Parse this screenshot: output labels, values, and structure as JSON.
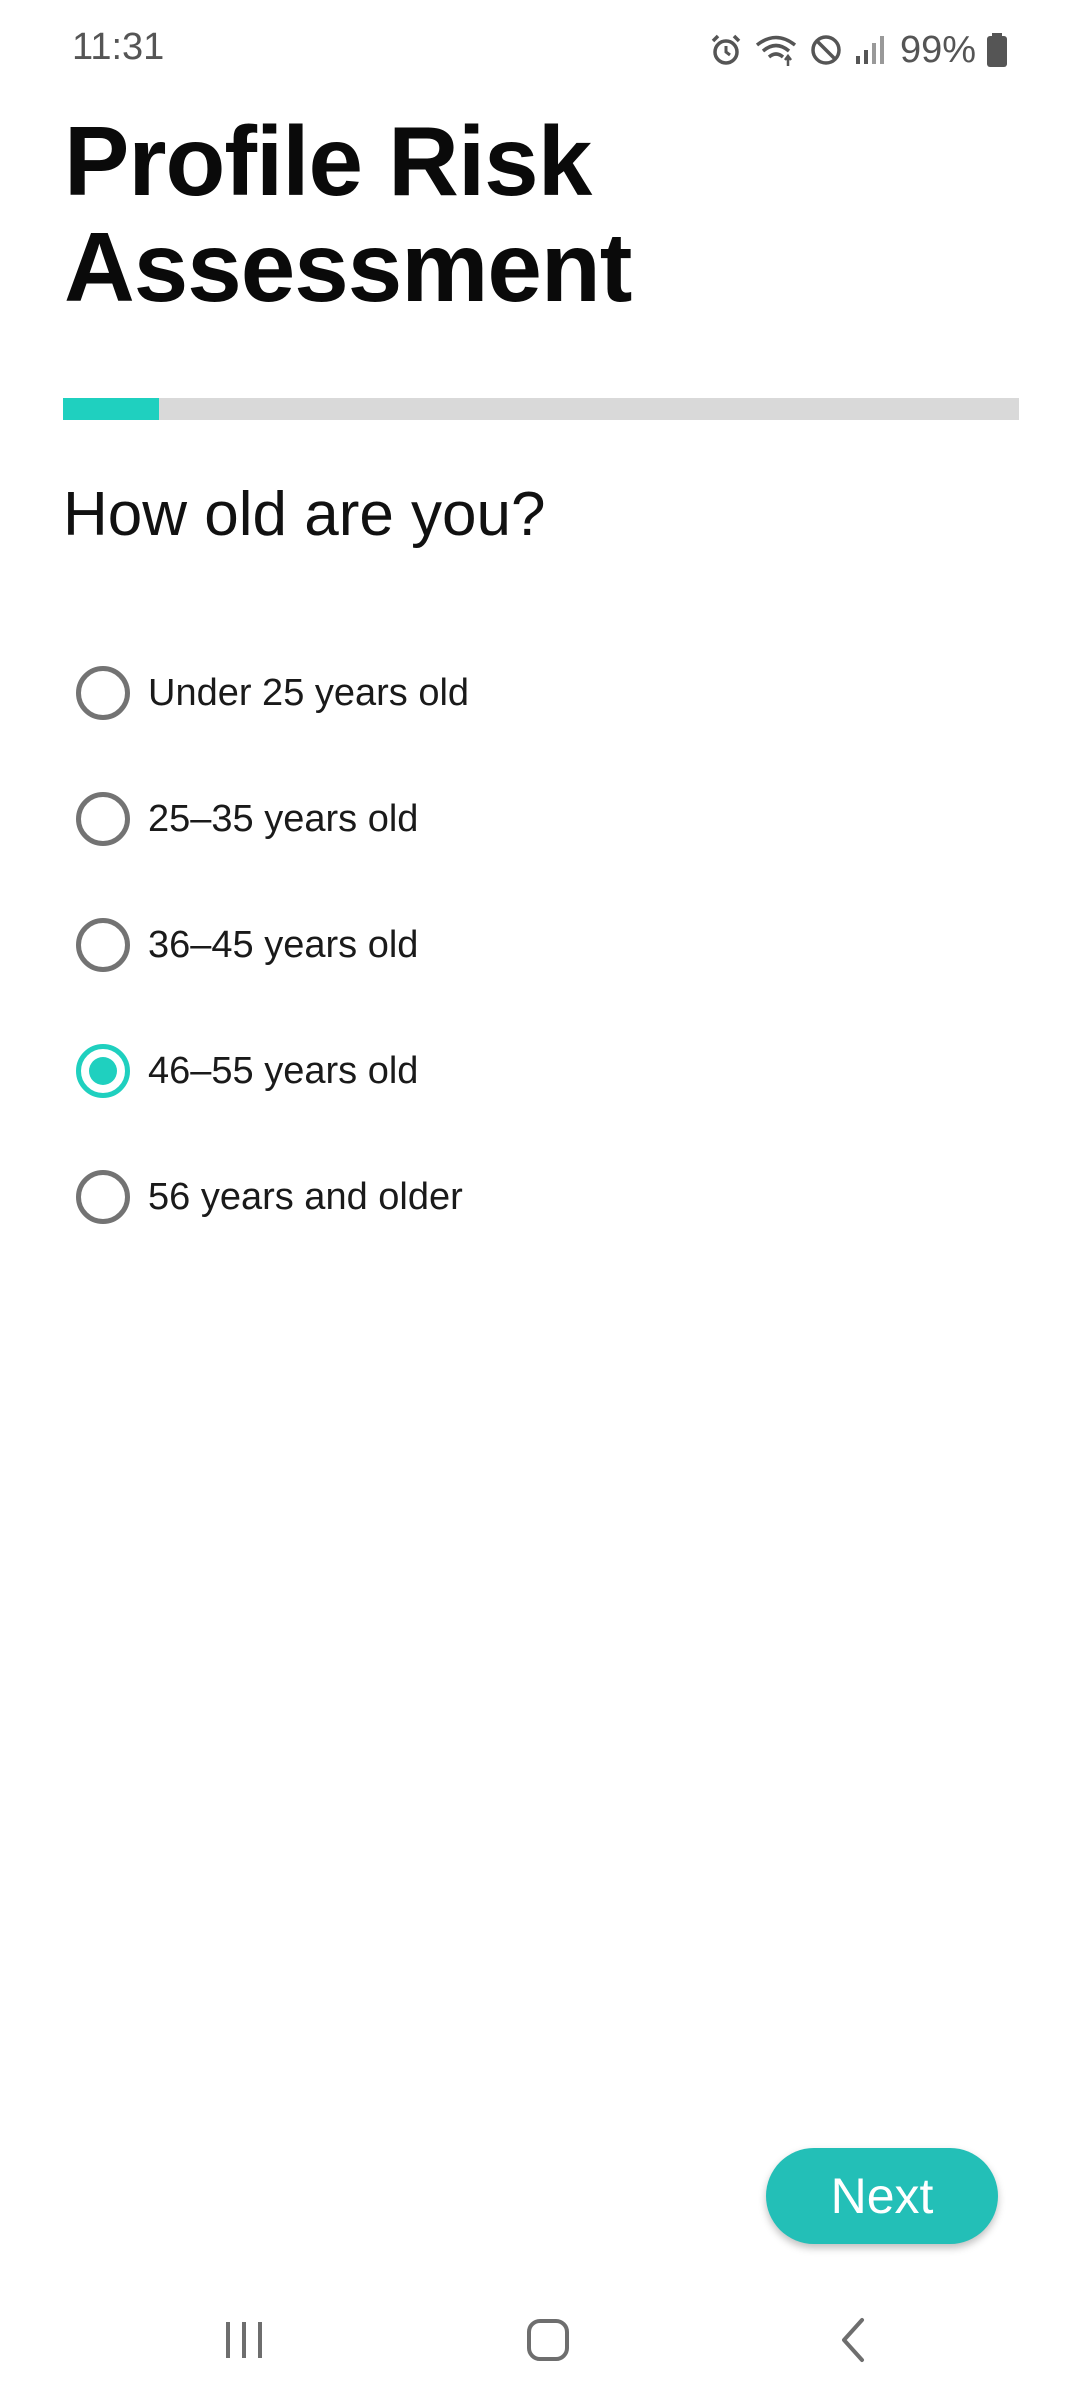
{
  "status_bar": {
    "time": "11:31",
    "battery_percent": "99%",
    "icons": [
      "alarm-icon",
      "wifi-icon",
      "do-not-disturb-icon",
      "signal-icon",
      "battery-icon"
    ]
  },
  "title": "Profile Risk Assessment",
  "progress": {
    "fraction": 0.1
  },
  "question": "How old are you?",
  "options": [
    {
      "label": "Under 25 years old",
      "selected": false
    },
    {
      "label": "25–35 years old",
      "selected": false
    },
    {
      "label": "36–45 years old",
      "selected": false
    },
    {
      "label": "46–55 years old",
      "selected": true
    },
    {
      "label": "56 years and older",
      "selected": false
    }
  ],
  "next_label": "Next",
  "nav_bar": {
    "icons": [
      "recent-apps-icon",
      "home-icon",
      "back-icon"
    ]
  },
  "colors": {
    "accent": "#1fd0bf",
    "button": "#23bfb7",
    "track": "#d9d9d9"
  }
}
